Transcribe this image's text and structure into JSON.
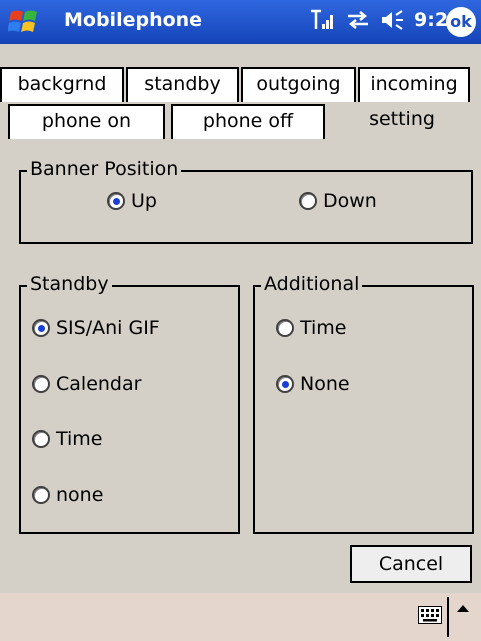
{
  "titlebar": {
    "title": "Mobilephone",
    "time": "9:27",
    "ok_label": "ok",
    "icons": [
      "signal-icon",
      "sync-icon",
      "speaker-icon"
    ]
  },
  "tabs_row1": [
    {
      "label": "backgrnd"
    },
    {
      "label": "standby"
    },
    {
      "label": "outgoing"
    },
    {
      "label": "incoming"
    }
  ],
  "tabs_row2": [
    {
      "label": "phone on"
    },
    {
      "label": "phone off"
    },
    {
      "label": "setting",
      "active": true
    }
  ],
  "banner": {
    "title": "Banner Position",
    "options": [
      {
        "label": "Up",
        "selected": true
      },
      {
        "label": "Down",
        "selected": false
      }
    ]
  },
  "standby": {
    "title": "Standby",
    "options": [
      {
        "label": "SIS/Ani GIF",
        "selected": true
      },
      {
        "label": "Calendar",
        "selected": false
      },
      {
        "label": "Time",
        "selected": false
      },
      {
        "label": "none",
        "selected": false
      }
    ]
  },
  "additional": {
    "title": "Additional",
    "options": [
      {
        "label": "Time",
        "selected": false
      },
      {
        "label": "None",
        "selected": true
      }
    ]
  },
  "buttons": {
    "cancel": "Cancel"
  },
  "colors": {
    "titlebar": "#1d4fc0",
    "radio_dot": "#1a3fd8",
    "bottom_bar": "#e4d6cc"
  }
}
